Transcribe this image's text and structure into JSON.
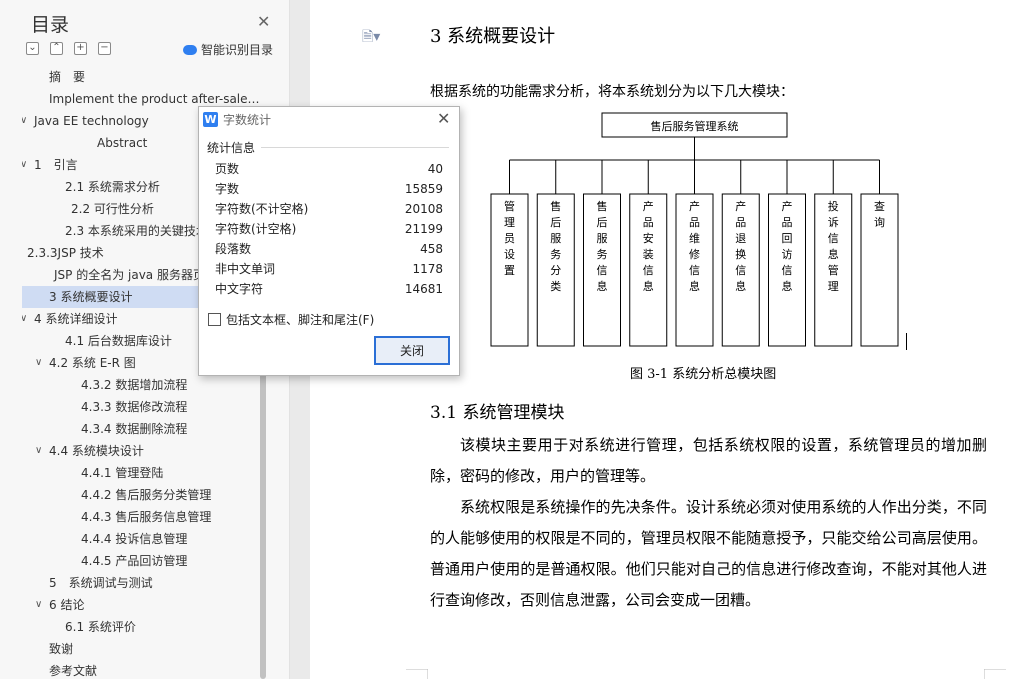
{
  "nav": {
    "title": "目录",
    "smart_label": "智能识别目录",
    "items": [
      {
        "label": "摘　要",
        "caret": ""
      },
      {
        "label": "Implement the product after-sale…",
        "caret": ""
      },
      {
        "label": "Java EE technology",
        "caret": "∨"
      },
      {
        "label": "Abstract",
        "caret": ""
      },
      {
        "label": "1　引言",
        "caret": "∨"
      },
      {
        "label": "2.1 系统需求分析",
        "caret": ""
      },
      {
        "label": "2.2 可行性分析",
        "caret": ""
      },
      {
        "label": "2.3 本系统采用的关键技术",
        "caret": ""
      },
      {
        "label": "2.3.3JSP 技术",
        "caret": ""
      },
      {
        "label": "JSP 的全名为 java 服务器页",
        "caret": ""
      },
      {
        "label": "3 系统概要设计",
        "caret": ""
      },
      {
        "label": "4 系统详细设计",
        "caret": "∨"
      },
      {
        "label": "4.1 后台数据库设计",
        "caret": ""
      },
      {
        "label": "4.2 系统 E-R 图",
        "caret": "∨"
      },
      {
        "label": "4.3.2 数据增加流程",
        "caret": ""
      },
      {
        "label": "4.3.3 数据修改流程",
        "caret": ""
      },
      {
        "label": "4.3.4 数据删除流程",
        "caret": ""
      },
      {
        "label": "4.4 系统模块设计",
        "caret": "∨"
      },
      {
        "label": "4.4.1 管理登陆",
        "caret": ""
      },
      {
        "label": "4.4.2 售后服务分类管理",
        "caret": ""
      },
      {
        "label": "4.4.3 售后服务信息管理",
        "caret": ""
      },
      {
        "label": "4.4.4 投诉信息管理",
        "caret": ""
      },
      {
        "label": "4.4.5 产品回访管理",
        "caret": ""
      },
      {
        "label": "5　系统调试与测试",
        "caret": ""
      },
      {
        "label": "6 结论",
        "caret": "∨"
      },
      {
        "label": "6.1 系统评价",
        "caret": ""
      },
      {
        "label": "致谢",
        "caret": ""
      },
      {
        "label": "参考文献",
        "caret": ""
      }
    ]
  },
  "doc": {
    "heading": "3  系统概要设计",
    "intro": "根据系统的功能需求分析，将本系统划分为以下几大模块：",
    "diagram": {
      "root": "售后服务管理系统",
      "modules": [
        "管理员设置",
        "售后服务分类",
        "售后服务信息",
        "产品安装信息",
        "产品维修信息",
        "产品退换信息",
        "产品回访信息",
        "投诉信息管理",
        "查询"
      ]
    },
    "caption": "图 3-1 系统分析总模块图",
    "subheading": "3.1  系统管理模块",
    "para1": "该模块主要用于对系统进行管理，包括系统权限的设置，系统管理员的增加删除，密码的修改，用户的管理等。",
    "para2": "系统权限是系统操作的先决条件。设计系统必须对使用系统的人作出分类，不同的人能够使用的权限是不同的，管理员权限不能随意授予，只能交给公司高层使用。普通用户使用的是普通权限。他们只能对自己的信息进行修改查询，不能对其他人进行查询修改，否则信息泄露，公司会变成一团糟。"
  },
  "dialog": {
    "title": "字数统计",
    "section": "统计信息",
    "stats": [
      {
        "label": "页数",
        "value": "40"
      },
      {
        "label": "字数",
        "value": "15859"
      },
      {
        "label": "字符数(不计空格)",
        "value": "20108"
      },
      {
        "label": "字符数(计空格)",
        "value": "21199"
      },
      {
        "label": "段落数",
        "value": "458"
      },
      {
        "label": "非中文单词",
        "value": "1178"
      },
      {
        "label": "中文字符",
        "value": "14681"
      }
    ],
    "checkbox_label": "包括文本框、脚注和尾注(F)",
    "close_label": "关闭"
  },
  "colors": {
    "selected_row": "#cfdcf3",
    "accent": "#2b6fd6"
  }
}
